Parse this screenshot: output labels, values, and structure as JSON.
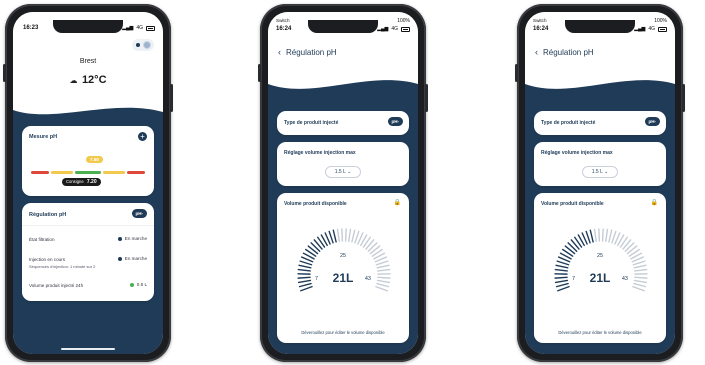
{
  "phone1": {
    "status_time": "16:23",
    "status_right": "4G",
    "city": "Brest",
    "weather_icon": "cloud-icon",
    "temperature": "12°C",
    "mesure": {
      "title": "Mesure pH",
      "current_value": "7.60",
      "consigne_label": "Consigne",
      "consigne_value": "7.20"
    },
    "regulation": {
      "title": "Régulation pH",
      "badge": "pH-",
      "rows": [
        {
          "label": "État filtration",
          "value": "En marche",
          "dot_color": "#1f3b57"
        },
        {
          "label": "Injection en cours",
          "value": "En marche",
          "dot_color": "#1f3b57"
        },
        {
          "label": "Volume produit injecté 24h",
          "value": "0.5 L",
          "dot_color": "#4caf50"
        }
      ],
      "sequence_note": "Séquences d'injection: 1 minute sur 2"
    }
  },
  "phone2": {
    "status_left": "Switch",
    "status_time": "16:24",
    "status_battery": "100%",
    "status_net": "4G",
    "title": "Régulation pH",
    "product_label": "Type de produit injecté",
    "product_badge": "pH-",
    "volume_max_label": "Réglage volume injection max",
    "volume_max_value": "1.5 L",
    "available_label": "Volume produit disponible",
    "gauge": {
      "value": "21L",
      "min": "7",
      "max": "43",
      "top": "25"
    },
    "footer_note": "Déverouillez pour éditer le volume disponible"
  },
  "phone3": {
    "status_left": "Switch",
    "status_time": "16:24",
    "status_battery": "100%",
    "status_net": "4G",
    "title": "Régulation pH",
    "product_label": "Type de produit injecté",
    "product_badge": "pH-",
    "volume_max_label": "Réglage volume injection max",
    "volume_max_value": "1.5 L",
    "available_label": "Volume produit disponible",
    "gauge": {
      "value": "21L",
      "min": "7",
      "max": "43",
      "top": "25"
    },
    "footer_note": "Déverouillez pour éditer le volume disponible"
  },
  "colors": {
    "navy": "#1f3b57",
    "scale_red": "#e0473b",
    "scale_yellow": "#f2c94c",
    "scale_green": "#4caf50"
  }
}
